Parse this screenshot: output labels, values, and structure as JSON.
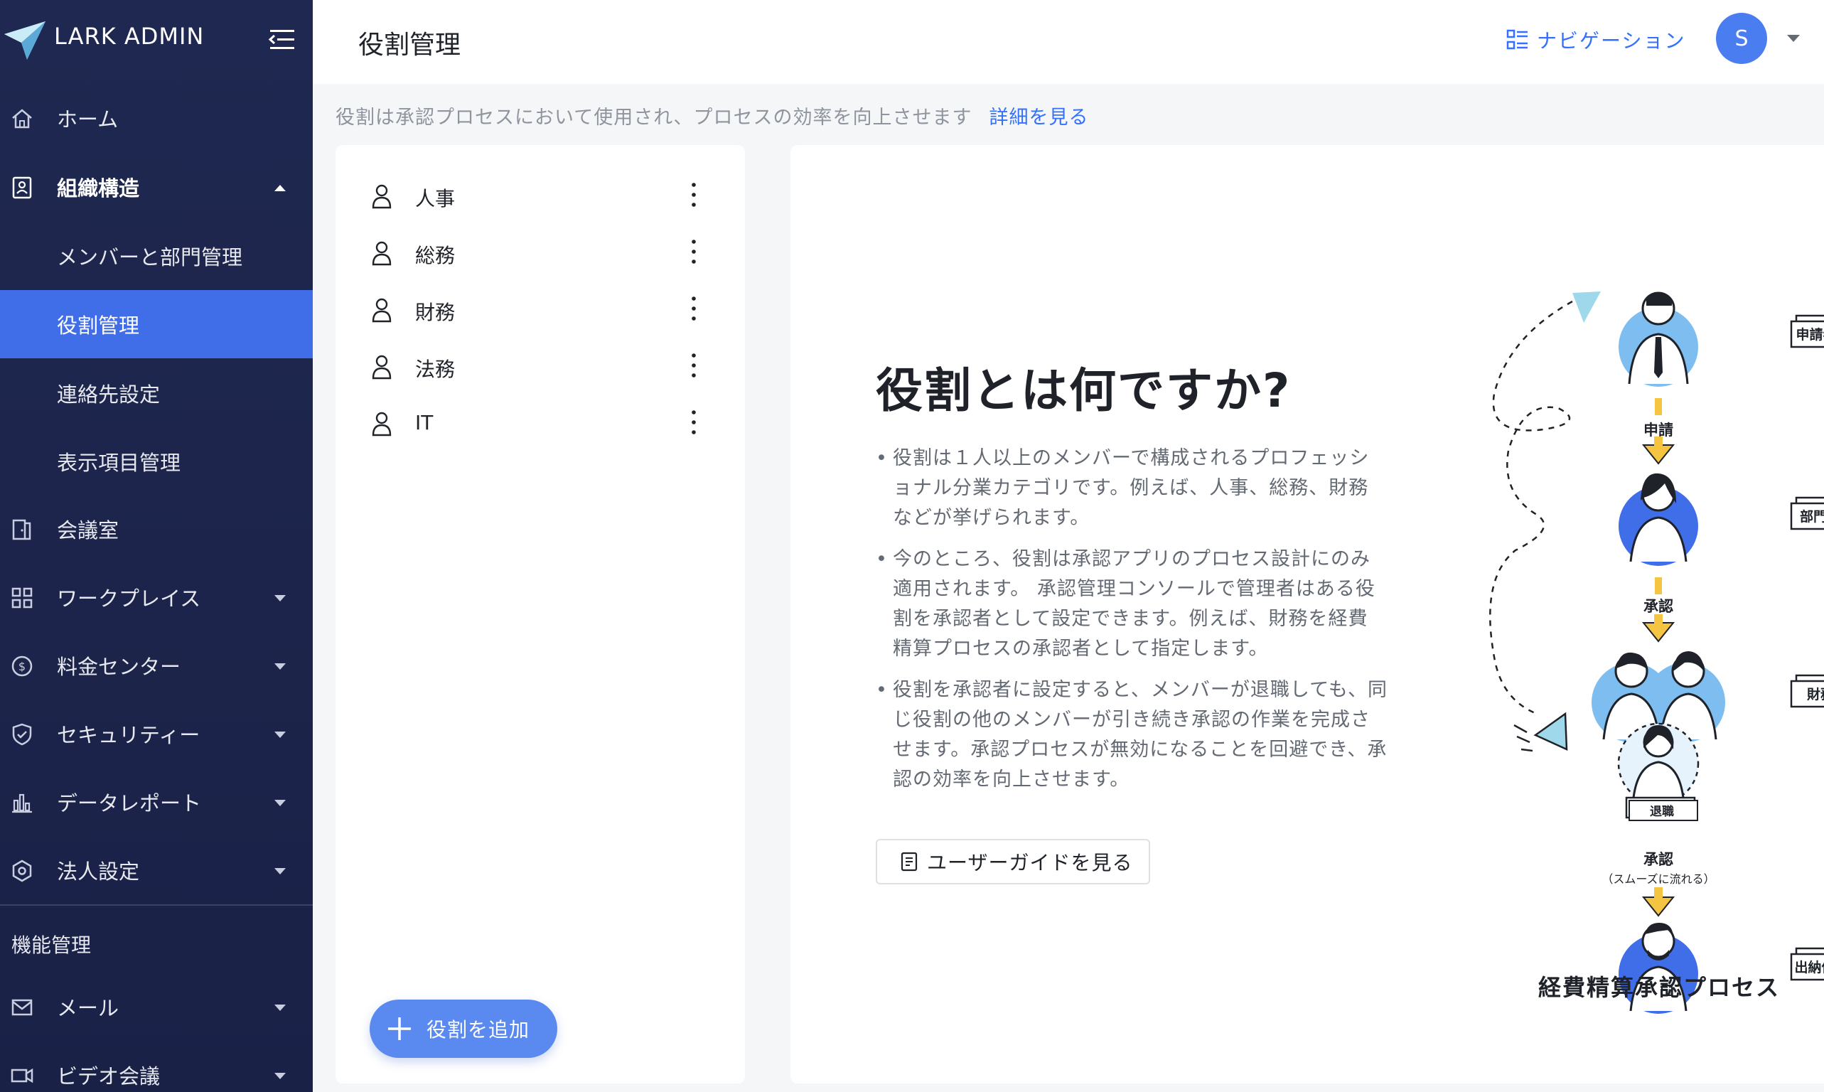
{
  "brand": {
    "name": "LARK ADMIN"
  },
  "sidebar": {
    "items": [
      {
        "label": "ホーム",
        "icon": "home-icon"
      },
      {
        "label": "組織構造",
        "icon": "contacts-icon"
      },
      {
        "label": "メンバーと部門管理"
      },
      {
        "label": "役割管理"
      },
      {
        "label": "連絡先設定"
      },
      {
        "label": "表示項目管理"
      },
      {
        "label": "会議室",
        "icon": "door-icon"
      },
      {
        "label": "ワークプレイス",
        "icon": "grid-icon"
      },
      {
        "label": "料金センター",
        "icon": "dollar-icon"
      },
      {
        "label": "セキュリティー",
        "icon": "shield-icon"
      },
      {
        "label": "データレポート",
        "icon": "bar-chart-icon"
      },
      {
        "label": "法人設定",
        "icon": "settings-icon"
      }
    ],
    "section_title": "機能管理",
    "feature_items": [
      {
        "label": "メール",
        "icon": "mail-icon"
      },
      {
        "label": "ビデオ会議",
        "icon": "video-icon"
      }
    ]
  },
  "header": {
    "title": "役割管理",
    "navigation_label": "ナビゲーション",
    "avatar_initial": "S"
  },
  "info_line": {
    "text": "役割は承認プロセスにおいて使用され、プロセスの効率を向上させます",
    "link": "詳細を見る"
  },
  "roles": [
    {
      "label": "人事"
    },
    {
      "label": "総務"
    },
    {
      "label": "財務"
    },
    {
      "label": "法務"
    },
    {
      "label": "IT"
    }
  ],
  "add_role_label": "役割を追加",
  "detail": {
    "heading": "役割とは何ですか?",
    "bullets": [
      "役割は１人以上のメンバーで構成されるプロフェッショナル分業カテゴリです。例えば、人事、総務、財務などが挙げられます。",
      "今のところ、役割は承認アプリのプロセス設計にのみ適用されます。 承認管理コンソールで管理者はある役割を承認者として設定できます。例えば、財務を経費精算プロセスの承認者として指定します。",
      "役割を承認者に設定すると、メンバーが退職しても、同じ役割の他のメンバーが引き続き承認の作業を完成させます。承認プロセスが無効になることを回避でき、承認の効率を向上させます。"
    ],
    "guide_button": "ユーザーガイドを見る",
    "illustration": {
      "title": "経費精算承認プロセス",
      "tags": [
        "申請者",
        "部門マネージ",
        "財務審査",
        "出納係"
      ],
      "steps": [
        "申請",
        "承認",
        "退職",
        "承認",
        "（スムーズに流れる）"
      ]
    }
  },
  "colors": {
    "sidebar_bg": "#1f2850",
    "accent": "#3f6ee8",
    "link": "#3370ff",
    "arrow": "#f5c542"
  }
}
